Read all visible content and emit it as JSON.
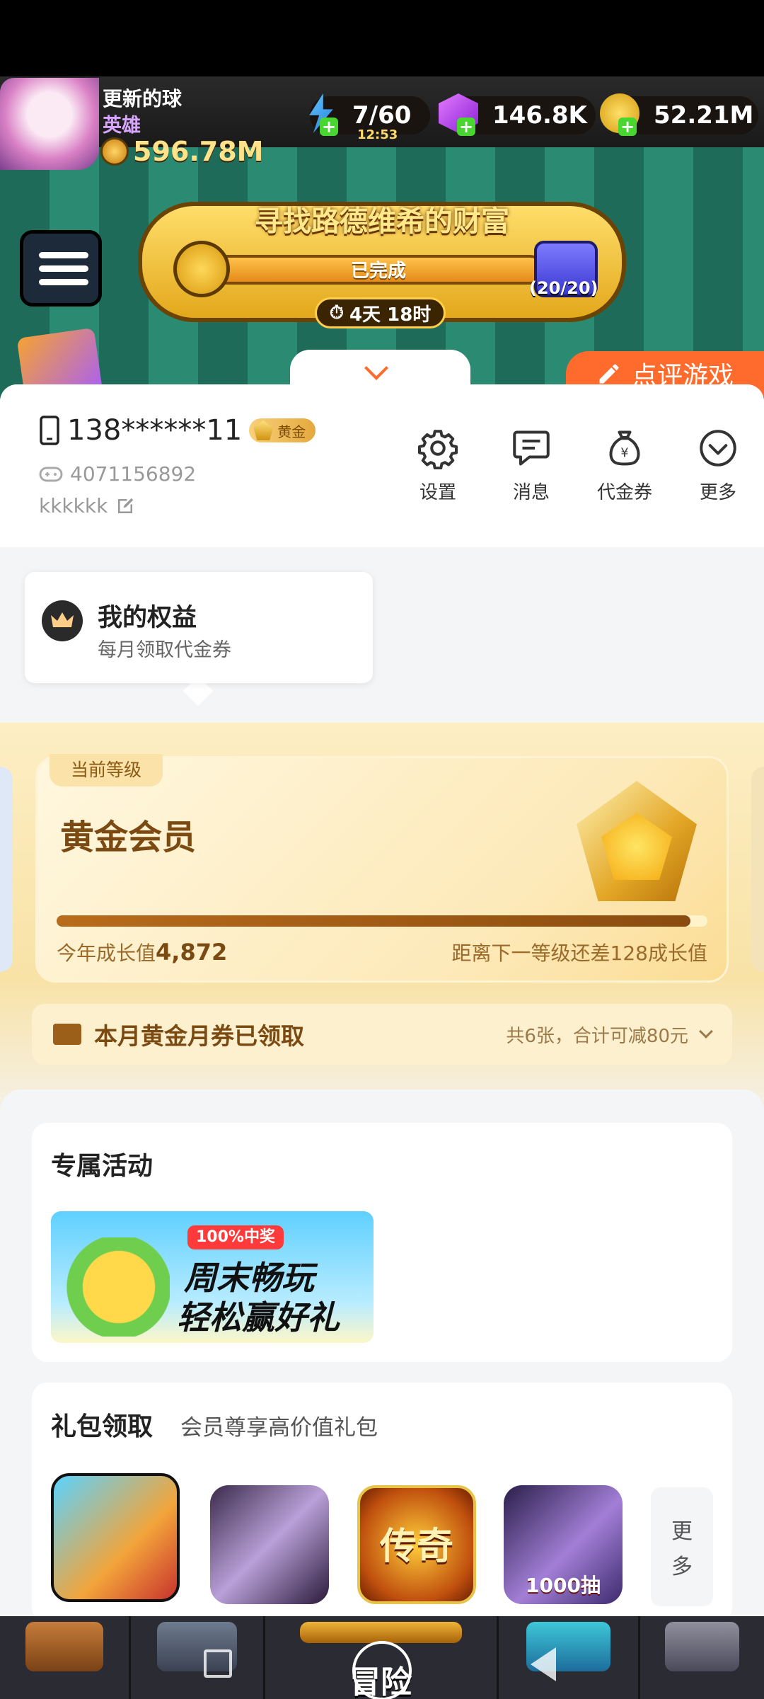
{
  "game": {
    "player_name": "更新的球",
    "player_title": "英雄",
    "power": "596.78M",
    "energy": "7/60",
    "energy_timer": "12:53",
    "gems": "146.8K",
    "coins": "52.21M",
    "event_title": "寻找路德维希的财富",
    "event_status": "已完成",
    "event_count": "(20/20)",
    "event_timer": "4天 18时",
    "adventure_label": "冒险"
  },
  "review_button": "点评游戏",
  "user": {
    "phone": "138******11",
    "level_badge": "黄金",
    "uid": "4071156892",
    "nickname": "kkkkkk"
  },
  "quick_actions": [
    {
      "label": "设置",
      "icon": "gear-icon"
    },
    {
      "label": "消息",
      "icon": "message-icon"
    },
    {
      "label": "代金券",
      "icon": "money-bag-icon"
    },
    {
      "label": "更多",
      "icon": "chevron-circle-icon"
    }
  ],
  "benefit": {
    "title": "我的权益",
    "subtitle": "每月领取代金券"
  },
  "level": {
    "tag": "当前等级",
    "name": "黄金会员",
    "progress": 0.974,
    "growth_label": "今年成长值",
    "growth_value": "4,872",
    "next_level_text": "距离下一等级还差128成长值"
  },
  "coupon": {
    "title": "本月黄金月券已领取",
    "info": "共6张，合计可减80元"
  },
  "activity": {
    "title": "专属活动",
    "banner_tag": "100%中奖",
    "banner_line1": "周末畅玩",
    "banner_line2": "轻松赢好礼"
  },
  "gifts": {
    "title": "礼包领取",
    "subtitle": "会员尊享高价值礼包",
    "more_label_1": "更",
    "more_label_2": "多",
    "items": [
      {
        "name": "game-icon-1",
        "overlay": ""
      },
      {
        "name": "game-icon-2",
        "overlay": ""
      },
      {
        "name": "game-icon-3",
        "overlay": "传奇"
      },
      {
        "name": "game-icon-4",
        "overlay": "1000抽"
      }
    ]
  },
  "colors": {
    "accent": "#ff6b2c",
    "gold_text": "#7a4a12",
    "gold_bg": "#fdeec4"
  }
}
